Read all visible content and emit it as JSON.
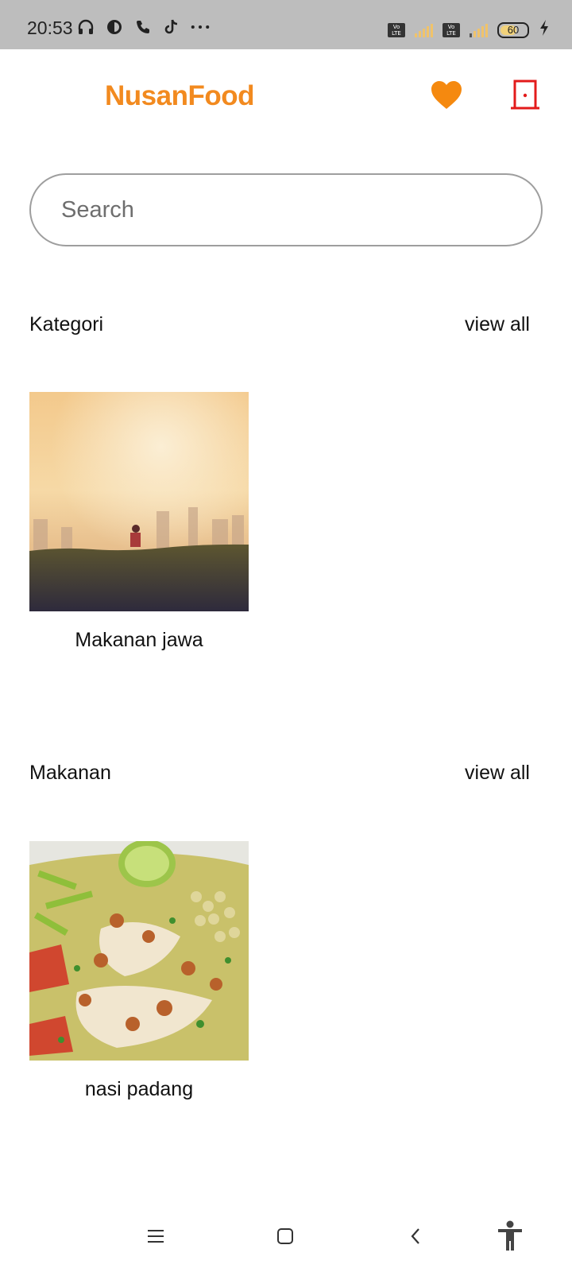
{
  "status_bar": {
    "time": "20:53",
    "battery": "60"
  },
  "header": {
    "brand": "NusanFood",
    "icons": {
      "favorite": "heart-icon",
      "logout": "door-exit-icon"
    },
    "colors": {
      "brand": "#f28a1f",
      "favorite": "#f5890f",
      "logout": "#e31b1b"
    }
  },
  "search": {
    "placeholder": "Search",
    "value": ""
  },
  "sections": {
    "kategori": {
      "title": "Kategori",
      "view_all": "view all",
      "items": [
        {
          "label": "Makanan jawa"
        }
      ]
    },
    "makanan": {
      "title": "Makanan",
      "view_all": "view all",
      "items": [
        {
          "label": "nasi padang"
        }
      ]
    }
  },
  "nav_bar": {
    "icons": [
      "menu-icon",
      "home-square-icon",
      "back-chevron-icon",
      "accessibility-icon"
    ]
  }
}
